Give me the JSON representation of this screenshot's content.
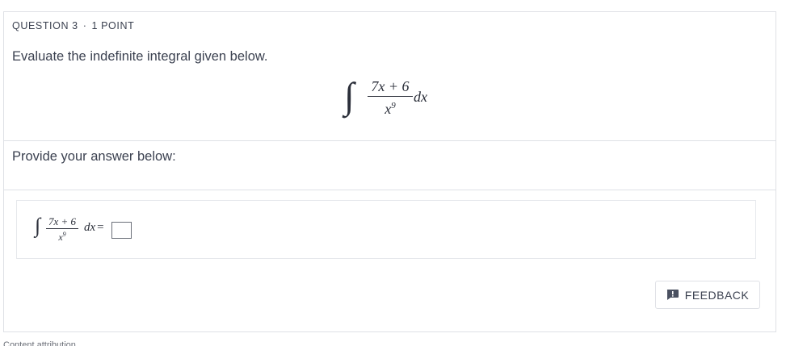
{
  "question": {
    "number_label": "QUESTION 3",
    "separator": "·",
    "points_label": "1 POINT",
    "prompt": "Evaluate the indefinite integral given below."
  },
  "formula": {
    "integral_sign": "∫",
    "numerator": "7x + 6",
    "denominator_base": "x",
    "denominator_exponent": "9",
    "differential": "dx"
  },
  "answer": {
    "label": "Provide your answer below:",
    "integral_sign": "∫",
    "numerator": "7x + 6",
    "denominator_base": "x",
    "denominator_exponent": "9",
    "differential": "dx",
    "equals": "=",
    "input_value": ""
  },
  "feedback": {
    "label": "FEEDBACK",
    "icon": "feedback-icon"
  },
  "footer": {
    "text": "Content attribution"
  }
}
